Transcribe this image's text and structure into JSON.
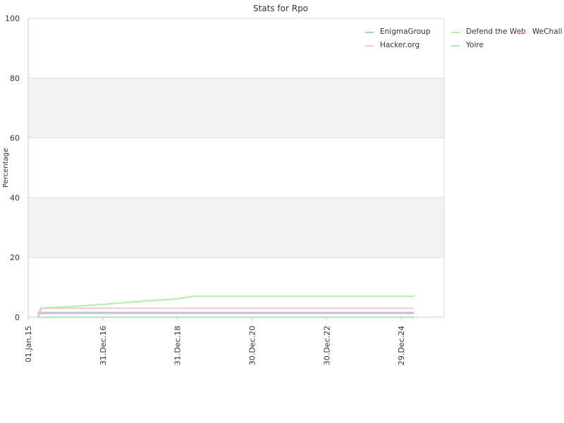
{
  "chart_data": {
    "type": "line",
    "title": "Stats for Rpo",
    "xlabel": "",
    "ylabel": "Percentage",
    "xlim": [
      "2015-01-01",
      "2026-02-21"
    ],
    "ylim": [
      0,
      100
    ],
    "y_ticks": [
      0,
      20,
      40,
      60,
      80,
      100
    ],
    "x_ticks": [
      {
        "date": "2015-01-01",
        "label": "01.Jan.15"
      },
      {
        "date": "2016-12-31",
        "label": "31.Dec.16"
      },
      {
        "date": "2018-12-31",
        "label": "31.Dec.18"
      },
      {
        "date": "2020-12-30",
        "label": "30.Dec.20"
      },
      {
        "date": "2022-12-30",
        "label": "30.Dec.22"
      },
      {
        "date": "2024-12-29",
        "label": "29.Dec.24"
      }
    ],
    "grid": true,
    "alternating_bands": true,
    "legend_position": "top-right",
    "series": [
      {
        "name": "EnigmaGroup",
        "color": "#a6c8ea",
        "points": [
          [
            "2015-04-01",
            1.6
          ],
          [
            "2025-05-01",
            1.6
          ]
        ]
      },
      {
        "name": "Defend the Web",
        "color": "#b2eea6",
        "points": [
          [
            "2015-04-01",
            0
          ],
          [
            "2015-05-15",
            3.1
          ],
          [
            "2016-01-01",
            3.5
          ],
          [
            "2017-01-01",
            4.3
          ],
          [
            "2018-01-01",
            5.3
          ],
          [
            "2019-01-01",
            6.2
          ],
          [
            "2019-06-01",
            7.0
          ],
          [
            "2025-05-01",
            7.0
          ]
        ]
      },
      {
        "name": "WeChall",
        "color": "#f0b0d0",
        "points": [
          [
            "2015-04-01",
            0
          ],
          [
            "2015-05-01",
            1.3
          ],
          [
            "2025-05-01",
            1.3
          ]
        ]
      },
      {
        "name": "Hacker.org",
        "color": "#f7c8c8",
        "points": [
          [
            "2015-04-01",
            0
          ],
          [
            "2015-05-01",
            3.0
          ],
          [
            "2025-05-01",
            3.0
          ]
        ]
      },
      {
        "name": "Yoire",
        "color": "#a6e8c2",
        "points": [
          [
            "2015-04-01",
            0
          ],
          [
            "2025-05-01",
            0
          ]
        ]
      }
    ]
  }
}
